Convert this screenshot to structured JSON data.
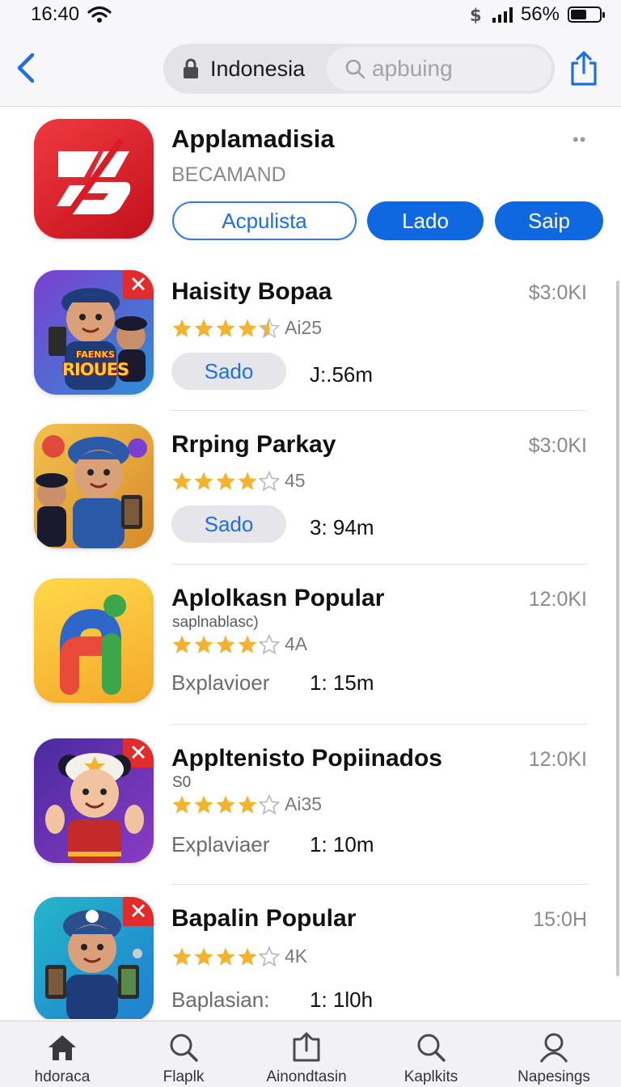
{
  "status_bar": {
    "time": "16:40",
    "battery_percent": "56%",
    "battery_level": 0.56,
    "icons": [
      "wifi-icon",
      "currency-icon",
      "signal-icon",
      "battery-icon"
    ]
  },
  "nav": {
    "region": "Indonesia",
    "search_placeholder": "apbuing",
    "icons": [
      "back-chevron-icon",
      "lock-icon",
      "search-icon",
      "share-icon"
    ]
  },
  "featured": {
    "title": "Applamadisia",
    "subtitle": "BECAMAND",
    "buttons": [
      "Acpulista",
      "Lado",
      "Saip"
    ],
    "icon_color": "#d81b24"
  },
  "apps": [
    {
      "title": "Haisity Bopaa",
      "size": "$3:0KI",
      "rating": 4.5,
      "rating_count": "Ai25",
      "action": "Sado",
      "category": "",
      "subtitle": "",
      "duration": "J:.56m",
      "icon_text": [
        "FAENKS",
        "RIOUES"
      ]
    },
    {
      "title": "Rrping Parkay",
      "size": "$3:0KI",
      "rating": 4,
      "rating_count": "45",
      "action": "Sado",
      "category": "",
      "subtitle": "",
      "duration": "3: 94m"
    },
    {
      "title": "Aplolkasn Popular",
      "size": "12:0KI",
      "rating": 4,
      "rating_count": "4A",
      "action": "",
      "category": "Bxplavioer",
      "subtitle": "saplnablasc)",
      "duration": "1: 15m"
    },
    {
      "title": "Appltenisto Popiinados",
      "size": "12:0KI",
      "rating": 4,
      "rating_count": "Ai35",
      "action": "",
      "category": "Explaviaer",
      "subtitle": "S0",
      "duration": "1: 10m"
    },
    {
      "title": "Bapalin Popular",
      "size": "15:0H",
      "rating": 4,
      "rating_count": "4K",
      "action": "",
      "category": "Baplasian:",
      "subtitle": "",
      "duration": "1: 1l0h"
    }
  ],
  "tabs": [
    {
      "label": "hdoraca",
      "icon": "home-icon"
    },
    {
      "label": "Flaplk",
      "icon": "search-icon"
    },
    {
      "label": "Ainondtasin",
      "icon": "updates-box-icon"
    },
    {
      "label": "Kaplkits",
      "icon": "search-icon"
    },
    {
      "label": "Napesings",
      "icon": "person-icon"
    }
  ],
  "colors": {
    "accent_blue": "#1068e0",
    "star_gold": "#f3b230",
    "star_empty": "#b8b8bc",
    "badge_red": "#e32b2b"
  }
}
